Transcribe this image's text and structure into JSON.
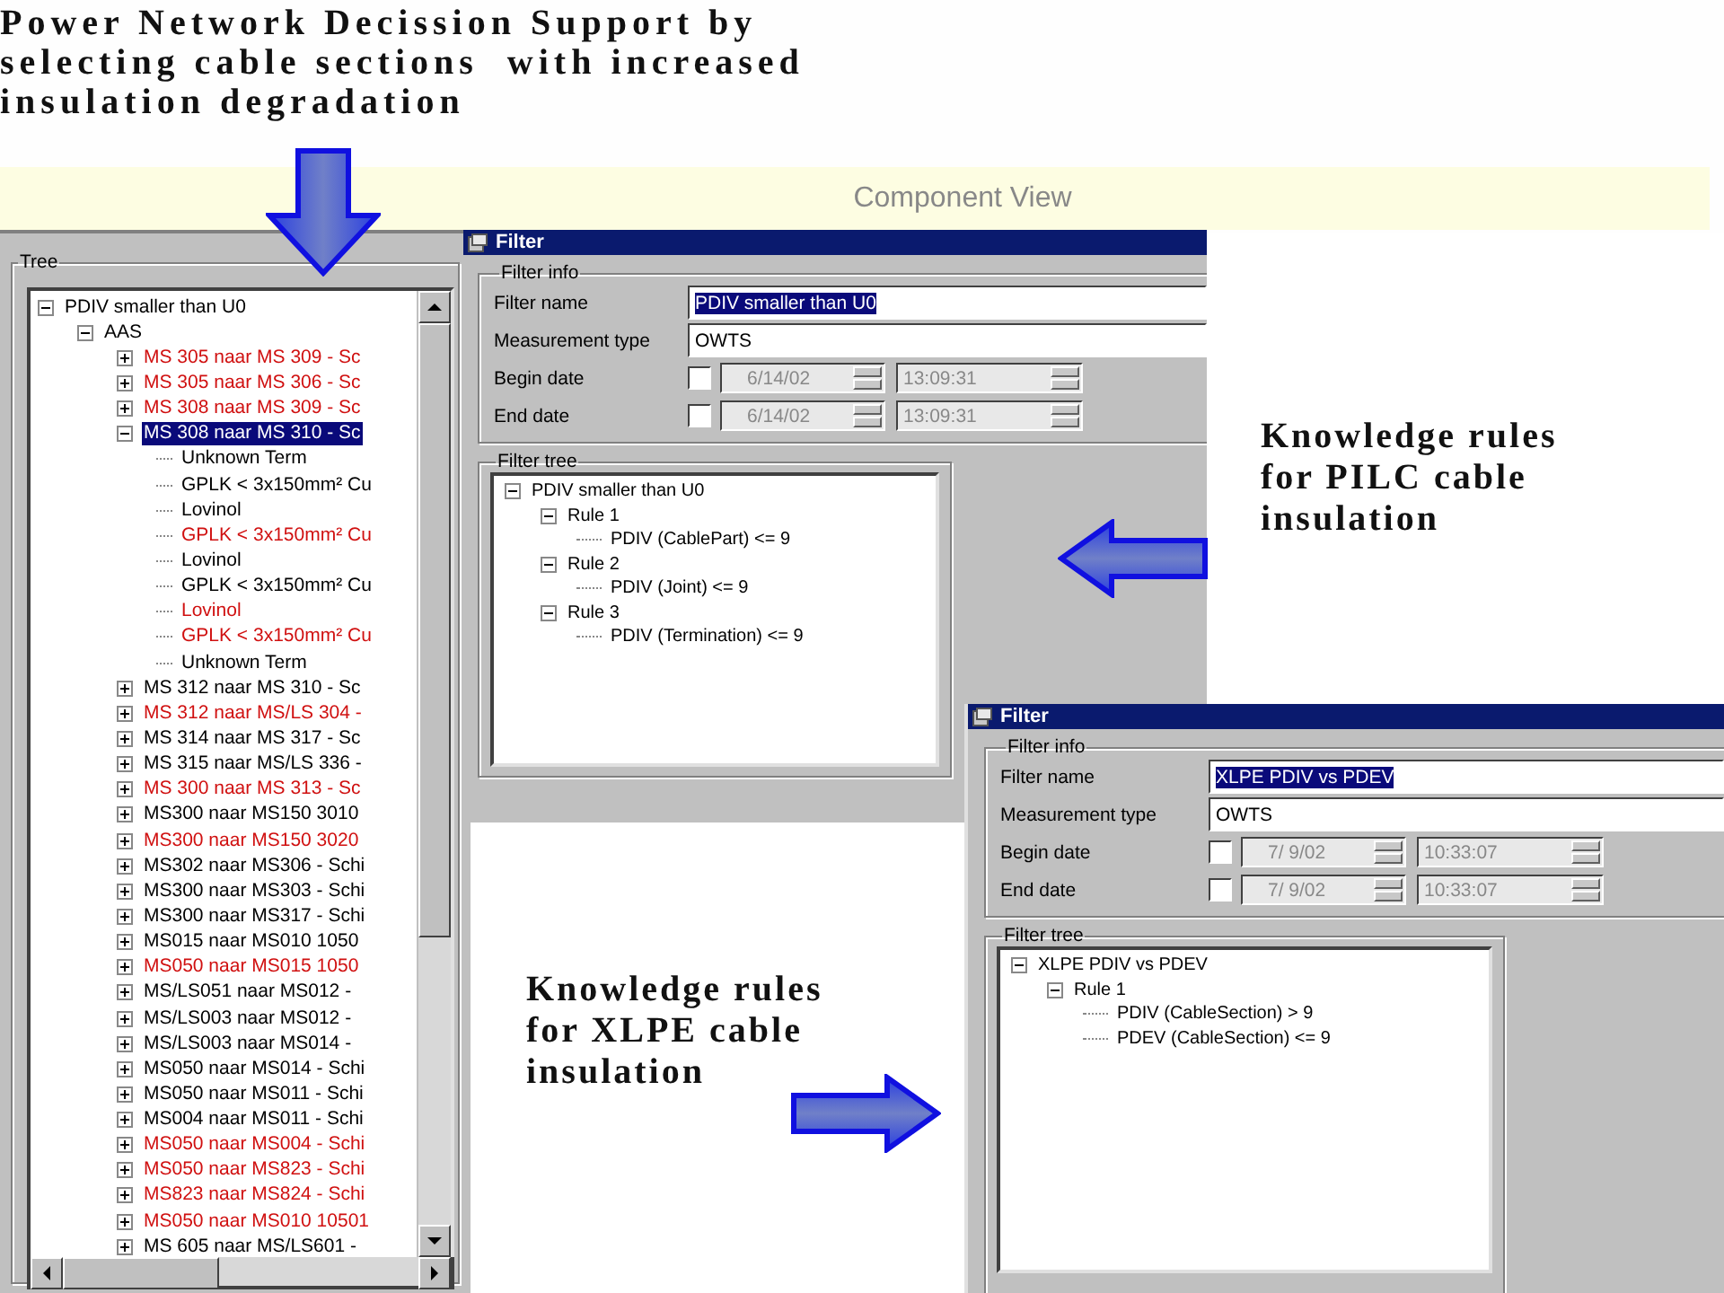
{
  "slide": {
    "title": "Power Network Decission Support by\nselecting cable sections  with increased\ninsulation degradation",
    "view_banner": "Component View"
  },
  "tree_panel": {
    "label": "Tree",
    "root": {
      "label": "PDIV smaller than U0",
      "expanded": true,
      "selected": false,
      "color": "#000000",
      "children": [
        {
          "label": "AAS",
          "expanded": true,
          "selected": false,
          "color": "#000000",
          "children": [
            {
              "label": "MS 305 naar MS 309 - Sc",
              "expanded": false,
              "selected": false,
              "color": "#d01010"
            },
            {
              "label": "MS 305 naar MS 306 - Sc",
              "expanded": false,
              "selected": false,
              "color": "#d01010"
            },
            {
              "label": "MS 308 naar MS 309 - Sc",
              "expanded": false,
              "selected": false,
              "color": "#d01010"
            },
            {
              "label": "MS 308 naar MS 310 - Sc",
              "expanded": true,
              "selected": true,
              "children": [
                {
                  "label": "Unknown Term",
                  "selected": false,
                  "color": "#000000"
                },
                {
                  "label": "GPLK < 3x150mm² Cu",
                  "selected": false,
                  "color": "#000000"
                },
                {
                  "label": "Lovinol",
                  "selected": false,
                  "color": "#000000"
                },
                {
                  "label": "GPLK < 3x150mm² Cu",
                  "selected": false,
                  "color": "#d01010"
                },
                {
                  "label": "Lovinol",
                  "selected": false,
                  "color": "#000000"
                },
                {
                  "label": "GPLK < 3x150mm² Cu",
                  "selected": false,
                  "color": "#000000"
                },
                {
                  "label": "Lovinol",
                  "selected": false,
                  "color": "#d01010"
                },
                {
                  "label": "GPLK < 3x150mm² Cu",
                  "selected": false,
                  "color": "#d01010"
                },
                {
                  "label": "Unknown Term",
                  "selected": false,
                  "color": "#000000"
                }
              ]
            },
            {
              "label": "MS 312 naar MS 310 - Sc",
              "expanded": false,
              "selected": false,
              "color": "#000000"
            },
            {
              "label": "MS 312 naar MS/LS 304 -",
              "expanded": false,
              "selected": false,
              "color": "#d01010"
            },
            {
              "label": "MS 314 naar MS 317 - Sc",
              "expanded": false,
              "selected": false,
              "color": "#000000"
            },
            {
              "label": "MS 315 naar MS/LS 336 -",
              "expanded": false,
              "selected": false,
              "color": "#000000"
            },
            {
              "label": "MS 300 naar MS 313 - Sc",
              "expanded": false,
              "selected": false,
              "color": "#d01010"
            },
            {
              "label": "MS300 naar MS150 3010",
              "expanded": false,
              "selected": false,
              "color": "#000000"
            },
            {
              "label": "MS300 naar MS150 3020",
              "expanded": false,
              "selected": false,
              "color": "#d01010"
            },
            {
              "label": "MS302 naar MS306 - Schi",
              "expanded": false,
              "selected": false,
              "color": "#000000"
            },
            {
              "label": "MS300 naar MS303 - Schi",
              "expanded": false,
              "selected": false,
              "color": "#000000"
            },
            {
              "label": "MS300 naar MS317 - Schi",
              "expanded": false,
              "selected": false,
              "color": "#000000"
            },
            {
              "label": "MS015 naar MS010 1050",
              "expanded": false,
              "selected": false,
              "color": "#000000"
            },
            {
              "label": "MS050 naar MS015 1050",
              "expanded": false,
              "selected": false,
              "color": "#d01010"
            },
            {
              "label": "MS/LS051 naar MS012 -",
              "expanded": false,
              "selected": false,
              "color": "#000000"
            },
            {
              "label": "MS/LS003 naar MS012 -",
              "expanded": false,
              "selected": false,
              "color": "#000000"
            },
            {
              "label": "MS/LS003 naar MS014 -",
              "expanded": false,
              "selected": false,
              "color": "#000000"
            },
            {
              "label": "MS050 naar MS014 - Schi",
              "expanded": false,
              "selected": false,
              "color": "#000000"
            },
            {
              "label": "MS050 naar MS011 - Schi",
              "expanded": false,
              "selected": false,
              "color": "#000000"
            },
            {
              "label": "MS004 naar MS011 - Schi",
              "expanded": false,
              "selected": false,
              "color": "#000000"
            },
            {
              "label": "MS050 naar MS004 - Schi",
              "expanded": false,
              "selected": false,
              "color": "#d01010"
            },
            {
              "label": "MS050 naar MS823 - Schi",
              "expanded": false,
              "selected": false,
              "color": "#d01010"
            },
            {
              "label": "MS823 naar MS824 - Schi",
              "expanded": false,
              "selected": false,
              "color": "#d01010"
            },
            {
              "label": "MS050 naar MS010 10501",
              "expanded": false,
              "selected": false,
              "color": "#d01010"
            },
            {
              "label": "MS 605 naar MS/LS601 -",
              "expanded": false,
              "selected": false,
              "color": "#000000"
            }
          ]
        }
      ]
    }
  },
  "filter_windows": [
    {
      "title": "Filter",
      "info_label": "Filter info",
      "fields": [
        {
          "kind": "text",
          "label": "Filter name",
          "value": "PDIV smaller than U0",
          "text_selected": true
        },
        {
          "kind": "text",
          "label": "Measurement type",
          "value": "OWTS",
          "text_selected": false
        },
        {
          "kind": "date",
          "label": "Begin date",
          "checked": false,
          "date": "6/14/02",
          "time": "13:09:31"
        },
        {
          "kind": "date",
          "label": "End date",
          "checked": false,
          "date": "6/14/02",
          "time": "13:09:31"
        }
      ],
      "tree_label": "Filter tree",
      "tree": {
        "label": "PDIV smaller than U0",
        "expanded": true,
        "children": [
          {
            "label": "Rule 1",
            "expanded": true,
            "children": [
              {
                "label": "PDIV (CablePart) <= 9"
              }
            ]
          },
          {
            "label": "Rule 2",
            "expanded": true,
            "children": [
              {
                "label": "PDIV (Joint) <= 9"
              }
            ]
          },
          {
            "label": "Rule 3",
            "expanded": true,
            "children": [
              {
                "label": "PDIV (Termination) <= 9"
              }
            ]
          }
        ]
      }
    },
    {
      "title": "Filter",
      "info_label": "Filter info",
      "fields": [
        {
          "kind": "text",
          "label": "Filter name",
          "value": "XLPE PDIV vs PDEV",
          "text_selected": true
        },
        {
          "kind": "text",
          "label": "Measurement type",
          "value": "OWTS",
          "text_selected": false
        },
        {
          "kind": "date",
          "label": "Begin date",
          "checked": false,
          "date": "7/ 9/02",
          "time": "10:33:07"
        },
        {
          "kind": "date",
          "label": "End date",
          "checked": false,
          "date": "7/ 9/02",
          "time": "10:33:07"
        }
      ],
      "tree_label": "Filter tree",
      "tree": {
        "label": "XLPE PDIV vs PDEV",
        "expanded": true,
        "children": [
          {
            "label": "Rule 1",
            "expanded": true,
            "children": [
              {
                "label": "PDIV (CableSection) > 9"
              },
              {
                "label": "PDEV (CableSection) <= 9"
              }
            ]
          }
        ]
      }
    }
  ],
  "callouts": [
    {
      "text": "Knowledge rules for PILC cable insulation"
    },
    {
      "text": "Knowledge rules for XLPE cable insulation"
    }
  ]
}
